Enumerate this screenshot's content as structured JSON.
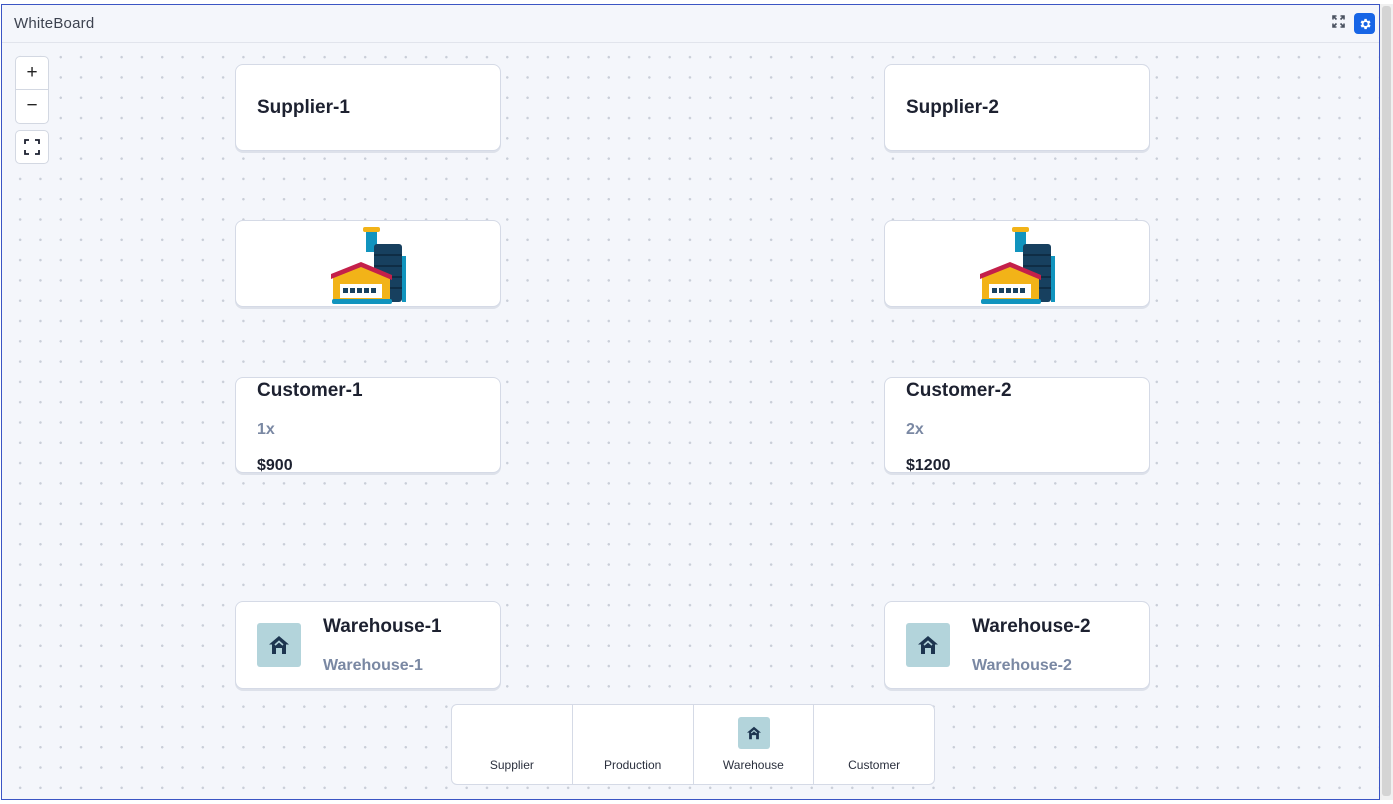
{
  "window": {
    "title": "WhiteBoard",
    "expand_icon": "expand-icon",
    "settings_icon": "gear-icon",
    "accent": "#1765e6"
  },
  "toolbar": {
    "zoom_in_label": "+",
    "zoom_out_label": "−",
    "fit_icon": "fit-view-icon"
  },
  "nodes": {
    "supplier_1": {
      "title": "Supplier-1"
    },
    "supplier_2": {
      "title": "Supplier-2"
    },
    "production_1": {
      "icon": "factory-icon"
    },
    "production_2": {
      "icon": "factory-icon"
    },
    "customer_1": {
      "title": "Customer-1",
      "quantity": "1x",
      "price": "$900"
    },
    "customer_2": {
      "title": "Customer-2",
      "quantity": "2x",
      "price": "$1200"
    },
    "warehouse_1": {
      "title": "Warehouse-1",
      "subtitle": "Warehouse-1",
      "icon": "home-icon"
    },
    "warehouse_2": {
      "title": "Warehouse-2",
      "subtitle": "Warehouse-2",
      "icon": "home-icon"
    }
  },
  "palette": {
    "items": [
      {
        "label": "Supplier"
      },
      {
        "label": "Production"
      },
      {
        "label": "Warehouse",
        "icon": "home-icon"
      },
      {
        "label": "Customer"
      }
    ]
  }
}
